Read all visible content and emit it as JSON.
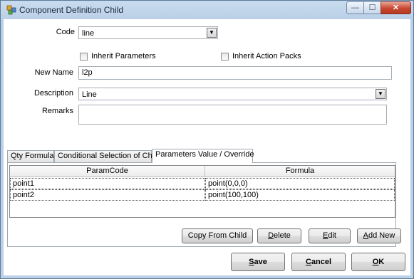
{
  "window": {
    "title": "Component Definition Child",
    "minimize_glyph": "—",
    "maximize_glyph": "☐",
    "close_glyph": "✕"
  },
  "form": {
    "code_label": "Code",
    "code_value": "line",
    "inherit_parameters_label": "Inherit Parameters",
    "inherit_action_packs_label": "Inherit Action Packs",
    "new_name_label": "New Name",
    "new_name_value": "l2p",
    "description_label": "Description",
    "description_value": "Line",
    "remarks_label": "Remarks",
    "remarks_value": ""
  },
  "tabs": [
    {
      "label": "Qty Formula"
    },
    {
      "label": "Conditional Selection of Child"
    },
    {
      "label": "Parameters Value / Override"
    }
  ],
  "grid": {
    "columns": [
      "ParamCode",
      "Formula"
    ],
    "rows": [
      {
        "param": "point1",
        "formula": "point(0,0,0)"
      },
      {
        "param": "point2",
        "formula": "point(100,100)"
      }
    ]
  },
  "buttons": {
    "copy_from_child": "Copy From Child",
    "delete_first": "D",
    "delete_rest": "elete",
    "edit_first": "E",
    "edit_rest": "dit",
    "add_new_first": "A",
    "add_new_rest": "dd New",
    "save_first": "S",
    "save_rest": "ave",
    "cancel_first": "C",
    "cancel_rest": "ancel",
    "ok_first": "O",
    "ok_rest": "K"
  },
  "colors": {
    "title_bar": "#bcd1e8",
    "close_button": "#c8462f"
  },
  "icons": [
    "app-icon",
    "minimize-icon",
    "maximize-icon",
    "close-icon",
    "dropdown-arrow-icon",
    "checkbox"
  ]
}
